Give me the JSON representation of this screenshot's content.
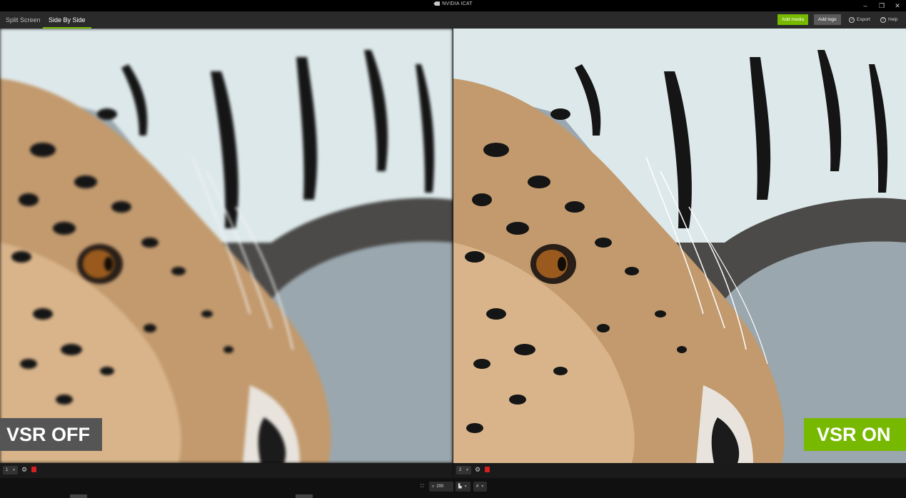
{
  "app": {
    "title": "NVIDIA ICAT"
  },
  "window_controls": {
    "minimize": "–",
    "restore": "❐",
    "close": "✕"
  },
  "tabs": [
    {
      "label": "Split Screen",
      "active": false
    },
    {
      "label": "Side By Side",
      "active": true
    }
  ],
  "toolbar": {
    "add_media": "Add media",
    "add_logo": "Add logo",
    "export": "Export",
    "help": "Help"
  },
  "panes": [
    {
      "label": "VSR OFF",
      "selector_value": "1",
      "label_color": "#555555"
    },
    {
      "label": "VSR ON",
      "selector_value": "2",
      "label_color": "#76b900"
    }
  ],
  "bottom": {
    "zoom_value": "200"
  },
  "colors": {
    "accent": "#76b900",
    "toolbar_bg": "#2a2a2a",
    "delete": "#d42020"
  },
  "icons": [
    "nvidia-logo-icon",
    "export-icon",
    "help-icon",
    "gear-icon",
    "trash-icon",
    "fullscreen-icon",
    "zoom-icon",
    "histogram-icon",
    "grid-icon",
    "chevron-down-icon"
  ]
}
